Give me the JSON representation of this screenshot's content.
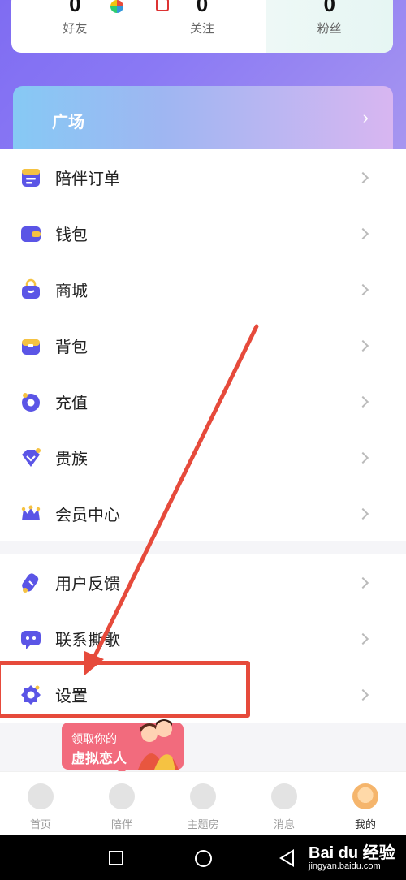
{
  "stats": [
    {
      "value": "0",
      "label": "好友"
    },
    {
      "value": "0",
      "label": "关注"
    },
    {
      "value": "0",
      "label": "粉丝"
    }
  ],
  "plaza": {
    "label": "广场",
    "arrow": "›"
  },
  "menu_group1": [
    {
      "label": "陪伴订单",
      "icon": "order-icon"
    },
    {
      "label": "钱包",
      "icon": "wallet-icon"
    },
    {
      "label": "商城",
      "icon": "shop-bag-icon"
    },
    {
      "label": "背包",
      "icon": "backpack-icon"
    },
    {
      "label": "充值",
      "icon": "recharge-icon"
    },
    {
      "label": "贵族",
      "icon": "noble-gem-icon"
    },
    {
      "label": "会员中心",
      "icon": "crown-icon"
    }
  ],
  "menu_group2": [
    {
      "label": "用户反馈",
      "icon": "feedback-pen-icon"
    },
    {
      "label": "联系撕歌",
      "icon": "chat-icon"
    },
    {
      "label": "设置",
      "icon": "gear-icon"
    }
  ],
  "promo": {
    "line1": "领取你的",
    "line2": "虚拟恋人"
  },
  "tabs": [
    {
      "label": "首页",
      "icon": "home-icon"
    },
    {
      "label": "陪伴",
      "icon": "heart-icon"
    },
    {
      "label": "主题房",
      "icon": "house-icon"
    },
    {
      "label": "消息",
      "icon": "message-icon"
    },
    {
      "label": "我的",
      "icon": "avatar-icon"
    }
  ],
  "watermark": {
    "main": "Bai du 经验",
    "sub": "jingyan.baidu.com"
  },
  "colors": {
    "accent": "#6a5cf0",
    "annotation": "#e64a3b",
    "promo": "#f26b7d"
  }
}
